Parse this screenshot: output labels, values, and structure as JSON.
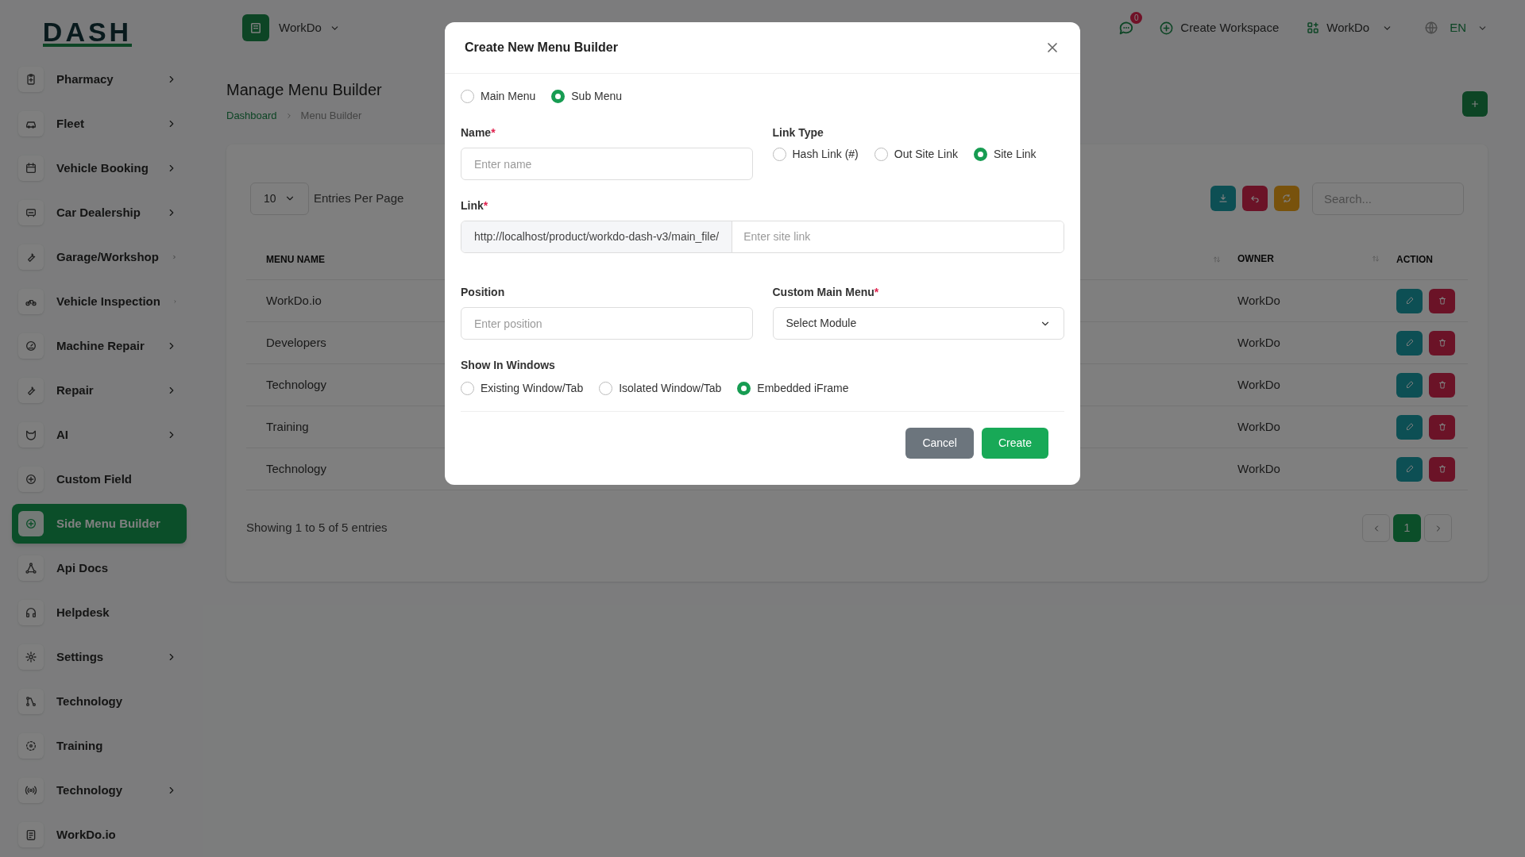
{
  "logo": "DASH",
  "sidebar": {
    "items": [
      {
        "label": "Pharmacy",
        "has_submenu": true,
        "selected": false
      },
      {
        "label": "Fleet",
        "has_submenu": true,
        "selected": false
      },
      {
        "label": "Vehicle Booking",
        "has_submenu": true,
        "selected": false
      },
      {
        "label": "Car Dealership",
        "has_submenu": true,
        "selected": false
      },
      {
        "label": "Garage/Workshop",
        "has_submenu": true,
        "selected": false
      },
      {
        "label": "Vehicle Inspection",
        "has_submenu": true,
        "selected": false
      },
      {
        "label": "Machine Repair",
        "has_submenu": true,
        "selected": false
      },
      {
        "label": "Repair",
        "has_submenu": true,
        "selected": false
      },
      {
        "label": "AI",
        "has_submenu": true,
        "selected": false
      },
      {
        "label": "Custom Field",
        "has_submenu": false,
        "selected": false
      },
      {
        "label": "Side Menu Builder",
        "has_submenu": false,
        "selected": true
      },
      {
        "label": "Api Docs",
        "has_submenu": false,
        "selected": false
      },
      {
        "label": "Helpdesk",
        "has_submenu": false,
        "selected": false
      },
      {
        "label": "Settings",
        "has_submenu": true,
        "selected": false
      },
      {
        "label": "Technology",
        "has_submenu": false,
        "selected": false
      },
      {
        "label": "Training",
        "has_submenu": false,
        "selected": false
      },
      {
        "label": "Technology",
        "has_submenu": true,
        "selected": false
      },
      {
        "label": "WorkDo.io",
        "has_submenu": false,
        "selected": false
      }
    ]
  },
  "topbar": {
    "workspace": "WorkDo",
    "notifications": "0",
    "create_workspace": "Create Workspace",
    "account": "WorkDo",
    "language": "EN"
  },
  "page": {
    "title": "Manage Menu Builder",
    "breadcrumb": [
      {
        "label": "Dashboard",
        "link": true
      },
      {
        "label": "Menu Builder",
        "link": false
      }
    ]
  },
  "table": {
    "entries": "10",
    "entries_label": "Entries Per Page",
    "search_placeholder": "Search...",
    "columns": [
      "MENU NAME",
      "OWNER",
      "ACTION"
    ],
    "rows": [
      {
        "menu_name": "WorkDo.io",
        "owner": "WorkDo"
      },
      {
        "menu_name": "Developers",
        "owner": "WorkDo"
      },
      {
        "menu_name": "Technology",
        "owner": "WorkDo"
      },
      {
        "menu_name": "Training",
        "owner": "WorkDo"
      },
      {
        "menu_name": "Technology",
        "owner": "WorkDo"
      }
    ],
    "summary": "Showing 1 to 5 of 5 entries",
    "pages": [
      {
        "label": "1",
        "selected": true
      }
    ]
  },
  "modal": {
    "title": "Create New Menu Builder",
    "menu_type": [
      {
        "label": "Main Menu",
        "selected": false
      },
      {
        "label": "Sub Menu",
        "selected": true
      }
    ],
    "name": {
      "label": "Name",
      "required_mark": "*",
      "placeholder": "Enter name"
    },
    "link_type": {
      "label": "Link Type",
      "options": [
        {
          "label": "Hash Link (#)",
          "selected": false
        },
        {
          "label": "Out Site Link",
          "selected": false
        },
        {
          "label": "Site Link",
          "selected": true
        }
      ]
    },
    "link": {
      "label": "Link",
      "required_mark": "*",
      "prefix": "http://localhost/product/workdo-dash-v3/main_file/",
      "placeholder": "Enter site link"
    },
    "position": {
      "label": "Position",
      "placeholder": "Enter position"
    },
    "custom_main_menu": {
      "label": "Custom Main Menu",
      "required_mark": "*",
      "value": "Select Module"
    },
    "show_in_windows": {
      "label": "Show In Windows",
      "options": [
        {
          "label": "Existing Window/Tab",
          "selected": false
        },
        {
          "label": "Isolated Window/Tab",
          "selected": false
        },
        {
          "label": "Embedded iFrame",
          "selected": true
        }
      ]
    },
    "buttons": [
      {
        "label": "Cancel",
        "kind": "secondary"
      },
      {
        "label": "Create",
        "kind": "primary"
      }
    ]
  }
}
